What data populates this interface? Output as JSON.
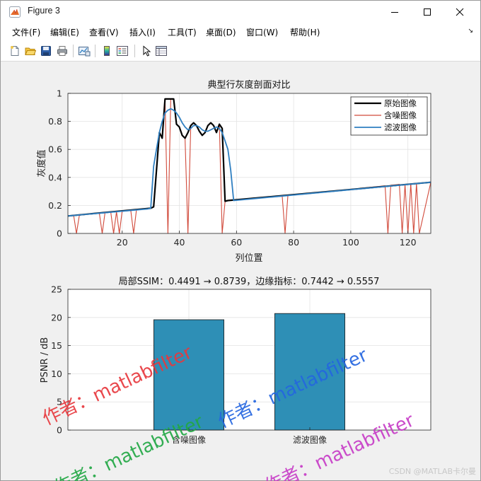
{
  "window": {
    "title": "Figure 3",
    "buttons": {
      "minimize": "minimize",
      "maximize": "maximize",
      "close": "close"
    }
  },
  "menu": {
    "items": [
      "文件(F)",
      "编辑(E)",
      "查看(V)",
      "插入(I)",
      "工具(T)",
      "桌面(D)",
      "窗口(W)",
      "帮助(H)"
    ],
    "overflow": "↘"
  },
  "toolbar": {
    "icons": [
      "new-figure-icon",
      "open-file-icon",
      "save-icon",
      "print-icon",
      "link-plot-icon",
      "insert-colorbar-icon",
      "insert-legend-icon",
      "edit-plot-arrow-icon",
      "property-inspector-icon"
    ]
  },
  "plot1": {
    "title": "典型行灰度剖面对比",
    "xlabel": "列位置",
    "ylabel": "灰度值",
    "legend": [
      "原始图像",
      "含噪图像",
      "滤波图像"
    ]
  },
  "plot2": {
    "title": "局部SSIM：0.4491 → 0.8739，边缘指标：0.7442 → 0.5557",
    "ylabel": "PSNR / dB"
  },
  "watermarks": [
    "作者：matlabfilter",
    "作者：matlabfilter",
    "作者：matlabfilter",
    "作者：matlabfilter"
  ],
  "footer": "CSDN @MATLAB卡尔曼",
  "colors": {
    "original": "#000000",
    "noisy": "#d14a3b",
    "filtered": "#2f7fc1",
    "bar": "#2e8fb6",
    "wm_red": "#e8383d",
    "wm_blue": "#2466e0",
    "wm_green": "#22a845",
    "wm_magenta": "#c73cc7"
  },
  "chart_data": [
    {
      "type": "line",
      "title": "典型行灰度剖面对比",
      "xlabel": "列位置",
      "ylabel": "灰度值",
      "xlim": [
        1,
        128
      ],
      "ylim": [
        0,
        1
      ],
      "xticks": [
        20,
        40,
        60,
        80,
        100,
        120
      ],
      "yticks": [
        0,
        0.2,
        0.4,
        0.6,
        0.8,
        1
      ],
      "grid": true,
      "legend_position": "top-right",
      "series": [
        {
          "name": "原始图像",
          "x": [
            1,
            30,
            31,
            32,
            33,
            34,
            35,
            36,
            37,
            38,
            39,
            40,
            41,
            42,
            43,
            44,
            45,
            46,
            47,
            48,
            49,
            50,
            51,
            52,
            53,
            54,
            55,
            56,
            57,
            128
          ],
          "y": [
            0.125,
            0.18,
            0.19,
            0.45,
            0.72,
            0.68,
            0.96,
            0.96,
            0.96,
            0.96,
            0.78,
            0.76,
            0.7,
            0.68,
            0.72,
            0.77,
            0.79,
            0.77,
            0.73,
            0.7,
            0.72,
            0.77,
            0.79,
            0.77,
            0.72,
            0.78,
            0.75,
            0.23,
            0.235,
            0.365
          ]
        },
        {
          "name": "含噪图像",
          "x": [
            1,
            3,
            4,
            5,
            12,
            13,
            14,
            16,
            17,
            18,
            19,
            20,
            23,
            24,
            25,
            30,
            31,
            32,
            33,
            34,
            35,
            36,
            37,
            38,
            39,
            40,
            41,
            42,
            43,
            44,
            45,
            46,
            47,
            48,
            49,
            50,
            51,
            52,
            53,
            54,
            55,
            56,
            57,
            76,
            77,
            78,
            112,
            113,
            114,
            117,
            118,
            119,
            120,
            121,
            122,
            123,
            124,
            128
          ],
          "y": [
            0.125,
            0.13,
            0.0,
            0.13,
            0.147,
            0.0,
            0.15,
            0.152,
            0.0,
            0.155,
            0.0,
            0.158,
            0.163,
            0.0,
            0.168,
            0.18,
            0.19,
            0.45,
            0.72,
            0.68,
            0.96,
            0.0,
            0.96,
            0.96,
            0.78,
            0.76,
            0.7,
            0.68,
            0.0,
            0.77,
            0.79,
            0.77,
            0.73,
            0.7,
            0.72,
            0.77,
            0.79,
            0.77,
            0.72,
            0.78,
            0.0,
            0.23,
            0.235,
            0.265,
            0.0,
            0.27,
            0.34,
            0.0,
            0.344,
            0.35,
            0.0,
            0.351,
            0.0,
            0.355,
            0.0,
            0.357,
            0.0,
            0.365
          ]
        },
        {
          "name": "滤波图像",
          "x": [
            1,
            29,
            30,
            31,
            32,
            33,
            34,
            35,
            36,
            37,
            38,
            39,
            40,
            41,
            42,
            43,
            44,
            45,
            46,
            47,
            48,
            49,
            50,
            51,
            52,
            53,
            54,
            55,
            56,
            57,
            58,
            59,
            128
          ],
          "y": [
            0.125,
            0.175,
            0.18,
            0.48,
            0.6,
            0.72,
            0.8,
            0.86,
            0.88,
            0.89,
            0.88,
            0.86,
            0.83,
            0.79,
            0.76,
            0.74,
            0.75,
            0.77,
            0.77,
            0.76,
            0.74,
            0.73,
            0.73,
            0.74,
            0.75,
            0.76,
            0.75,
            0.72,
            0.66,
            0.6,
            0.45,
            0.235,
            0.365
          ]
        }
      ]
    },
    {
      "type": "bar",
      "title": "局部SSIM：0.4491 → 0.8739，边缘指标：0.7442 → 0.5557",
      "xlabel": "",
      "ylabel": "PSNR / dB",
      "categories": [
        "含噪图像",
        "滤波图像"
      ],
      "values": [
        19.6,
        20.7
      ],
      "ylim": [
        0,
        25
      ],
      "yticks": [
        0,
        5,
        10,
        15,
        20,
        25
      ],
      "grid": true
    }
  ]
}
